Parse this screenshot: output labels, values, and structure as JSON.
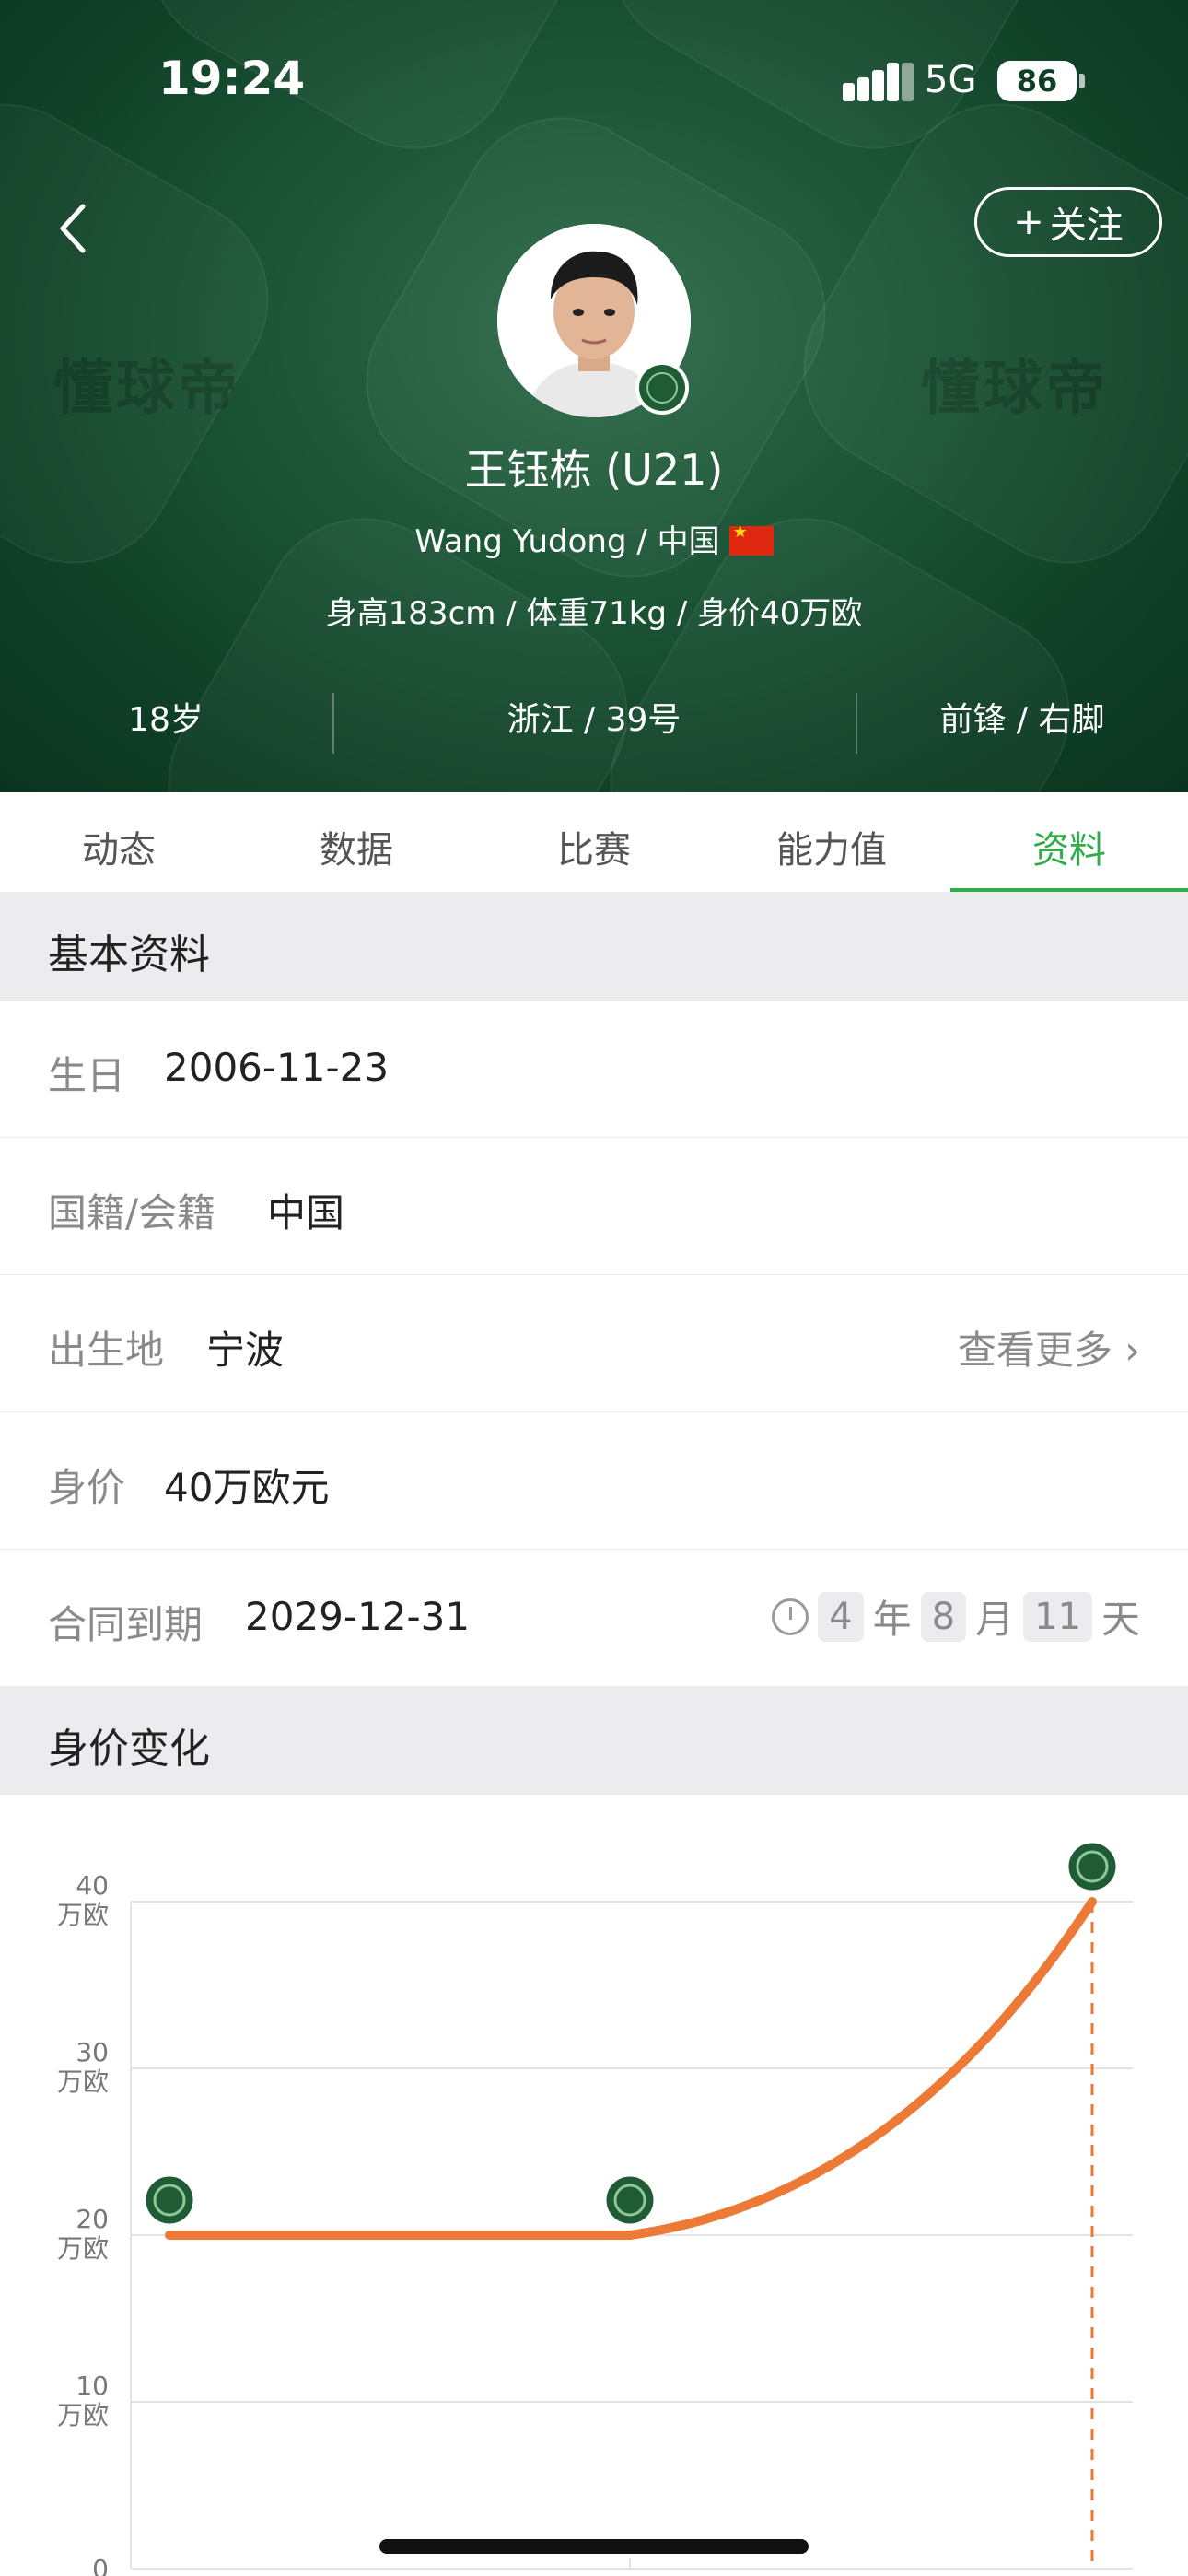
{
  "status": {
    "time": "19:24",
    "network": "5G",
    "battery": "86"
  },
  "header": {
    "follow_label": "关注",
    "watermark": "懂球帝",
    "player_name": "王钰栋 (U21)",
    "sub_line": "Wang Yudong / 中国",
    "body_line": "身高183cm / 体重71kg / 身价40万欧",
    "stats": [
      "18岁",
      "浙江 / 39号",
      "前锋 / 右脚"
    ]
  },
  "tabs": [
    {
      "label": "动态"
    },
    {
      "label": "数据"
    },
    {
      "label": "比赛"
    },
    {
      "label": "能力值"
    },
    {
      "label": "资料",
      "active": true
    }
  ],
  "basic_info": {
    "title": "基本资料",
    "rows": [
      {
        "label": "生日",
        "value": "2006-11-23"
      },
      {
        "label": "国籍/会籍",
        "value": "中国"
      },
      {
        "label": "出生地",
        "value": "宁波",
        "more": "查看更多"
      },
      {
        "label": "身价",
        "value": "40万欧元"
      },
      {
        "label": "合同到期",
        "value": "2029-12-31"
      }
    ],
    "countdown": {
      "years": "4",
      "year_unit": "年",
      "months": "8",
      "month_unit": "月",
      "days": "11",
      "day_unit": "天"
    }
  },
  "value_history": {
    "title": "身价变化"
  },
  "chart_data": {
    "type": "line",
    "ylim": [
      0,
      40
    ],
    "y_ticks": [
      {
        "value": 40,
        "label": "40",
        "unit": "万欧"
      },
      {
        "value": 30,
        "label": "30",
        "unit": "万欧"
      },
      {
        "value": 20,
        "label": "20",
        "unit": "万欧"
      },
      {
        "value": 10,
        "label": "10",
        "unit": "万欧"
      },
      {
        "value": 0,
        "label": "0",
        "unit": ""
      }
    ],
    "series": [
      {
        "values": [
          20,
          20,
          40
        ]
      }
    ],
    "grid": true,
    "colors": {
      "line": "#ec7a36",
      "grid": "#e3e3e3"
    }
  },
  "colors": {
    "accent": "#2fae4a",
    "header_bg": "#0f3f26"
  },
  "icons": {
    "back": "chevron-left-icon",
    "clock": "clock-icon",
    "chevron_more": "chevron-right-icon"
  }
}
